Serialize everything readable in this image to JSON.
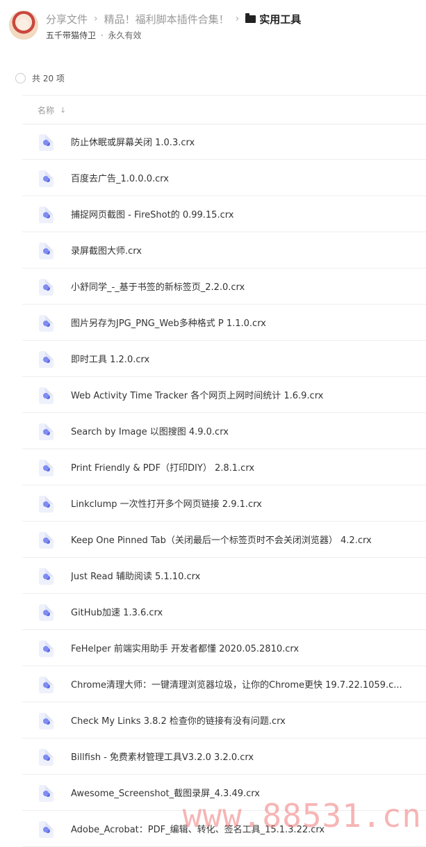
{
  "breadcrumb": {
    "items": [
      "分享文件",
      "精品！福利脚本插件合集！"
    ],
    "separator": "›",
    "current": "实用工具"
  },
  "owner": {
    "name": "五千带猫侍卫",
    "separator": "·",
    "validity": "永久有效"
  },
  "selection": {
    "count_label": "共 20 项"
  },
  "columns": {
    "name_label": "名称",
    "sort_icon": "↓"
  },
  "files": [
    {
      "name": "防止休眠或屏幕关闭 1.0.3.crx"
    },
    {
      "name": "百度去广告_1.0.0.0.crx"
    },
    {
      "name": "捕捉网页截图 - FireShot的 0.99.15.crx"
    },
    {
      "name": "录屏截图大师.crx"
    },
    {
      "name": "小舒同学_-_基于书签的新标签页_2.2.0.crx"
    },
    {
      "name": "图片另存为JPG_PNG_Web多种格式 P 1.1.0.crx"
    },
    {
      "name": "即时工具 1.2.0.crx"
    },
    {
      "name": "Web Activity Time Tracker 各个网页上网时间统计 1.6.9.crx"
    },
    {
      "name": "Search by Image 以图搜图 4.9.0.crx"
    },
    {
      "name": "Print Friendly & PDF（打印DIY） 2.8.1.crx"
    },
    {
      "name": "Linkclump 一次性打开多个网页链接 2.9.1.crx"
    },
    {
      "name": "Keep One Pinned Tab（关闭最后一个标签页时不会关闭浏览器） 4.2.crx"
    },
    {
      "name": "Just Read 辅助阅读 5.1.10.crx"
    },
    {
      "name": "GitHub加速 1.3.6.crx"
    },
    {
      "name": "FeHelper 前端实用助手 开发者都懂 2020.05.2810.crx"
    },
    {
      "name": "Chrome清理大师：一键清理浏览器垃圾，让你的Chrome更快 19.7.22.1059.c..."
    },
    {
      "name": "Check My Links 3.8.2 检查你的链接有没有问题.crx"
    },
    {
      "name": "Billfish - 免费素材管理工具V3.2.0 3.2.0.crx"
    },
    {
      "name": "Awesome_Screenshot_截图录屏_4.3.49.crx"
    },
    {
      "name": "Adobe_Acrobat：PDF_编辑、转化、签名工具_15.1.3.22.crx"
    }
  ],
  "watermark": "www.88531.cn",
  "icons": {
    "folder": "folder-icon",
    "file": "crx-file-icon",
    "avatar": "user-avatar"
  },
  "colors": {
    "file_icon_accent": "#7f8cf0",
    "watermark": "#f07878"
  }
}
